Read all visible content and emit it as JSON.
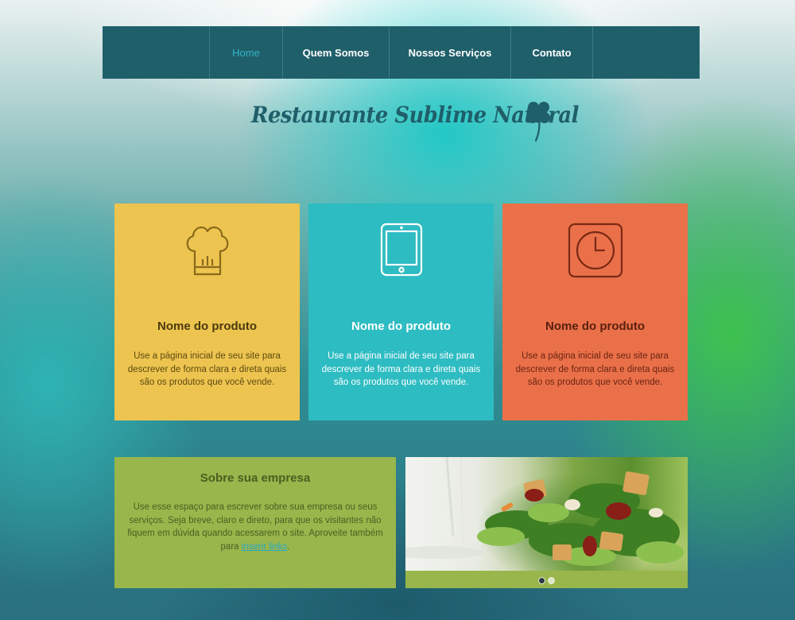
{
  "nav": {
    "items": [
      {
        "label": "Home",
        "active": true
      },
      {
        "label": "Quem Somos",
        "active": false
      },
      {
        "label": "Nossos Serviços",
        "active": false
      },
      {
        "label": "Contato",
        "active": false
      }
    ]
  },
  "logo": {
    "text": "Restaurante Sublime Natural",
    "icon": "clover-icon"
  },
  "cards": [
    {
      "icon": "chef-hat-icon",
      "title": "Nome do produto",
      "text": "Use a página inicial de seu site para descrever de forma clara e direta quais são os produtos que você vende.",
      "color": "#edc44f"
    },
    {
      "icon": "tablet-icon",
      "title": "Nome do produto",
      "text": "Use a página inicial de seu site para descrever de forma clara e direta quais são os produtos que você vende.",
      "color": "#2dbcc2"
    },
    {
      "icon": "clock-icon",
      "title": "Nome do produto",
      "text": "Use a página inicial de seu site para descrever de forma clara e direta quais são os produtos que você vende.",
      "color": "#ea7049"
    }
  ],
  "about": {
    "title": "Sobre sua empresa",
    "text_before": "Use esse espaço para escrever sobre sua empresa ou seus serviços. Seja breve, claro e direto, para que os visitantes não fiquem em dúvida quando acessarem o site. Aproveite também para ",
    "link": "inserir links",
    "text_after": ".",
    "color": "#98b64b"
  },
  "slider": {
    "image": "salad-photo",
    "slides": 2,
    "active_slide": 1
  }
}
